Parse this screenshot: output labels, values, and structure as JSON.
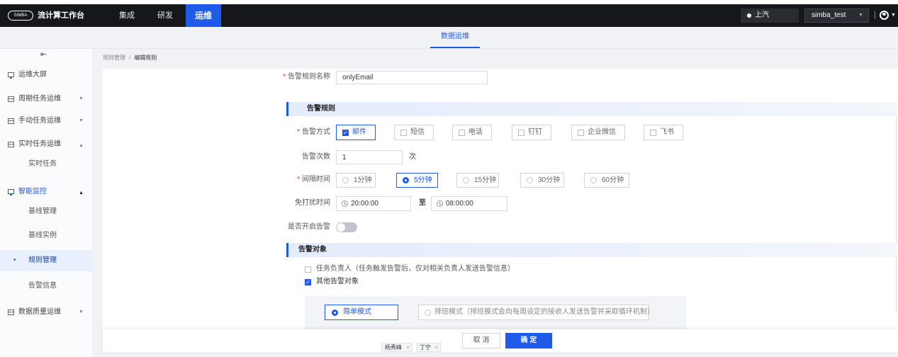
{
  "colors": {
    "primary": "#1f5ae8",
    "header_bg": "#16171b",
    "required": "#f5222d"
  },
  "header": {
    "logo_text": "SIMBA",
    "app_title": "流计算工作台",
    "nav": [
      {
        "label": "集成",
        "active": false
      },
      {
        "label": "研发",
        "active": false
      },
      {
        "label": "运维",
        "active": true
      }
    ],
    "tenant": "上汽",
    "project": "simba_test",
    "divider": "|"
  },
  "subnav": {
    "tabs": [
      {
        "label": "数据运维",
        "active": true
      }
    ]
  },
  "sidebar": {
    "items": [
      {
        "label": "运维大屏",
        "icon": "monitor-icon"
      },
      {
        "label": "周期任务运维",
        "icon": "grid-icon",
        "expanded": false
      },
      {
        "label": "手动任务运维",
        "icon": "grid-icon",
        "expanded": false
      },
      {
        "label": "实时任务运维",
        "icon": "grid-icon",
        "expanded": true,
        "children": [
          {
            "label": "实时任务"
          }
        ]
      },
      {
        "label": "智能监控",
        "icon": "monitor-icon",
        "expanded": true,
        "active": true,
        "children": [
          {
            "label": "基线管理"
          },
          {
            "label": "基线实例"
          },
          {
            "label": "规则管理",
            "active": true
          },
          {
            "label": "告警信息"
          }
        ]
      },
      {
        "label": "数据质量运维",
        "icon": "grid-icon",
        "expanded": false
      }
    ]
  },
  "breadcrumb": {
    "items": [
      "规则管理",
      "编辑规则"
    ],
    "separator": "/"
  },
  "form": {
    "required_mark": "*",
    "rule_name": {
      "label": "告警规则名称",
      "value": "onlyEmail"
    },
    "section_rules": "告警规则",
    "alert_method": {
      "label": "告警方式",
      "options": [
        {
          "label": "邮件",
          "checked": true
        },
        {
          "label": "短信",
          "checked": false
        },
        {
          "label": "电话",
          "checked": false
        },
        {
          "label": "钉钉",
          "checked": false
        },
        {
          "label": "企业微信",
          "checked": false
        },
        {
          "label": "飞书",
          "checked": false
        }
      ]
    },
    "alert_count": {
      "label": "告警次数",
      "value": "1",
      "unit": "次"
    },
    "interval": {
      "label": "间隔时间",
      "options": [
        {
          "label": "1分钟",
          "selected": false
        },
        {
          "label": "5分钟",
          "selected": true
        },
        {
          "label": "15分钟",
          "selected": false
        },
        {
          "label": "30分钟",
          "selected": false
        },
        {
          "label": "60分钟",
          "selected": false
        }
      ]
    },
    "quiet_time": {
      "label": "免打扰时间",
      "start": "20:00:00",
      "separator": "至",
      "end": "08:00:00"
    },
    "enable_alert": {
      "label": "是否开启告警",
      "on": false
    },
    "section_targets": "告警对象",
    "targets": {
      "owner": {
        "label": "任务负责人（任务触发告警后，仅对相关负责人发送告警信息）",
        "checked": false
      },
      "others": {
        "label": "其他告警对象",
        "checked": true
      },
      "modes": [
        {
          "label": "简单模式",
          "selected": true
        },
        {
          "label": "排班模式（排班模式会向每周设定的接收人发送告警并采取循环机制）",
          "selected": false
        }
      ]
    },
    "recipients": [
      {
        "name": "杨秀峰"
      },
      {
        "name": "丁宁"
      }
    ]
  },
  "footer": {
    "cancel_label": "取 消",
    "confirm_label": "确 定"
  }
}
